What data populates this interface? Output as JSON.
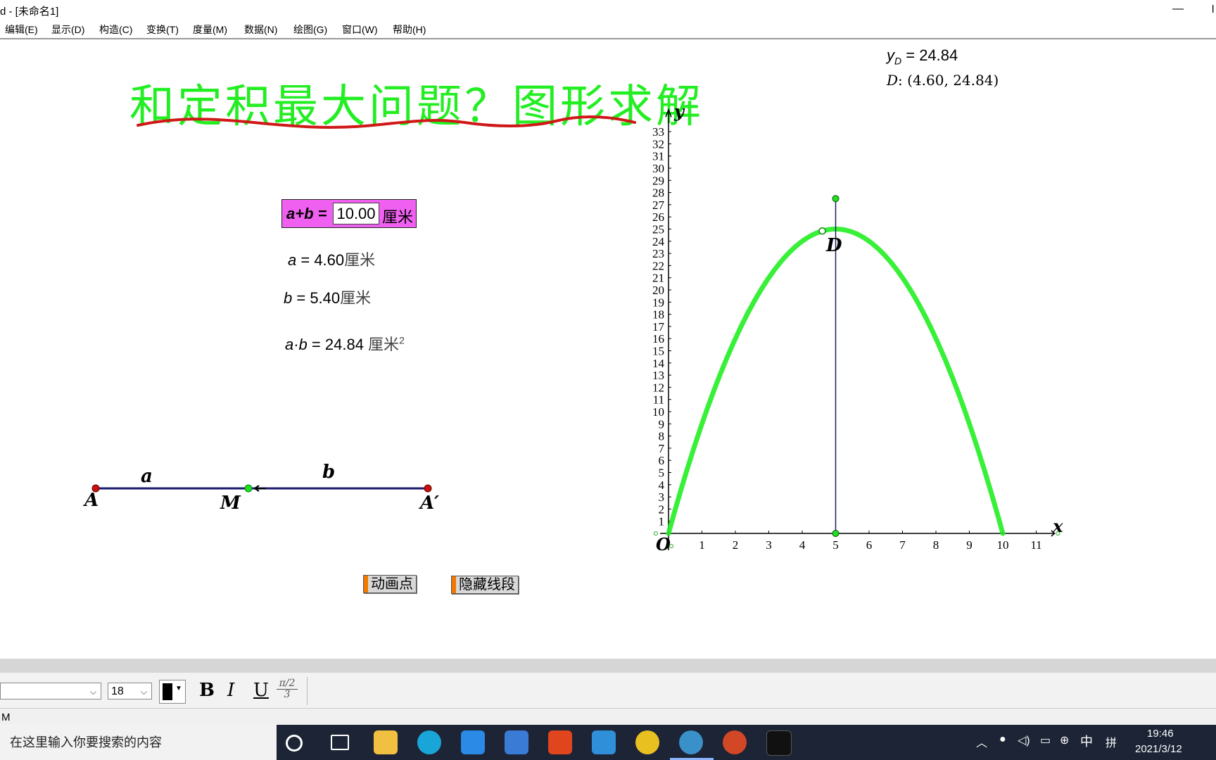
{
  "window": {
    "title": "d  - [未命名1]",
    "minimize_glyph": "—",
    "close_glyph": "l"
  },
  "menu": [
    "编辑(E)",
    "显示(D)",
    "构造(C)",
    "变换(T)",
    "度量(M)",
    "数据(N)",
    "绘图(G)",
    "窗口(W)",
    "帮助(H)"
  ],
  "canvas": {
    "title": "和定积最大问题？图形求解",
    "param": {
      "label": "a+b =",
      "value": "10.00",
      "unit": "厘米"
    },
    "measures": {
      "a_var": "a",
      "a_val": " = 4.60",
      "a_unit": "厘米",
      "b_var": "b",
      "b_val": " = 5.40",
      "b_unit": "厘米",
      "ab_var": "a·b",
      "ab_val": " = 24.84 ",
      "ab_unit": "厘米",
      "ab_sup": "2"
    },
    "yD": {
      "label": "y",
      "sub": "D",
      "value": " = 24.84"
    },
    "D_coord": {
      "name": "D",
      "text": ": (4.60, 24.84)"
    },
    "segment": {
      "A": "A",
      "M": "M",
      "A2": "A′",
      "a": "a",
      "b": "b"
    },
    "buttons": {
      "animate": "动画点",
      "hide": "隐藏线段"
    },
    "point_D_label": "D"
  },
  "chart_data": {
    "type": "line",
    "xlabel": "x",
    "ylabel": "y",
    "origin_label": "O",
    "xlim": [
      0,
      11
    ],
    "ylim": [
      0,
      33
    ],
    "xticks": [
      1,
      2,
      3,
      4,
      5,
      6,
      7,
      8,
      9,
      10,
      11
    ],
    "yticks": [
      1,
      2,
      3,
      4,
      5,
      6,
      7,
      8,
      9,
      10,
      11,
      12,
      13,
      14,
      15,
      16,
      17,
      18,
      19,
      20,
      21,
      22,
      23,
      24,
      25,
      26,
      27,
      28,
      29,
      30,
      31,
      32,
      33
    ],
    "series": [
      {
        "function": "y = x(10 - x)",
        "x_range": [
          0,
          10
        ],
        "color": "#22ee22"
      }
    ],
    "vertical_line_x": 5,
    "vertical_line_top_y": 27.5,
    "point_D": [
      4.6,
      24.84
    ],
    "colors": {
      "axis": "#000000",
      "curve": "#22ee22",
      "vertical": "#1a1a6e",
      "point": "#22dd22"
    }
  },
  "format_bar": {
    "font_name": "",
    "font_size": "18",
    "bold": "B",
    "italic": "I",
    "underline": "U",
    "math_top": "π/2",
    "math_bottom": "3"
  },
  "status": {
    "text": "M"
  },
  "taskbar": {
    "search_placeholder": "在这里输入你要搜索的内容",
    "ime": "中",
    "ime2": "拼",
    "time": "19:46",
    "date": "2021/3/12"
  }
}
